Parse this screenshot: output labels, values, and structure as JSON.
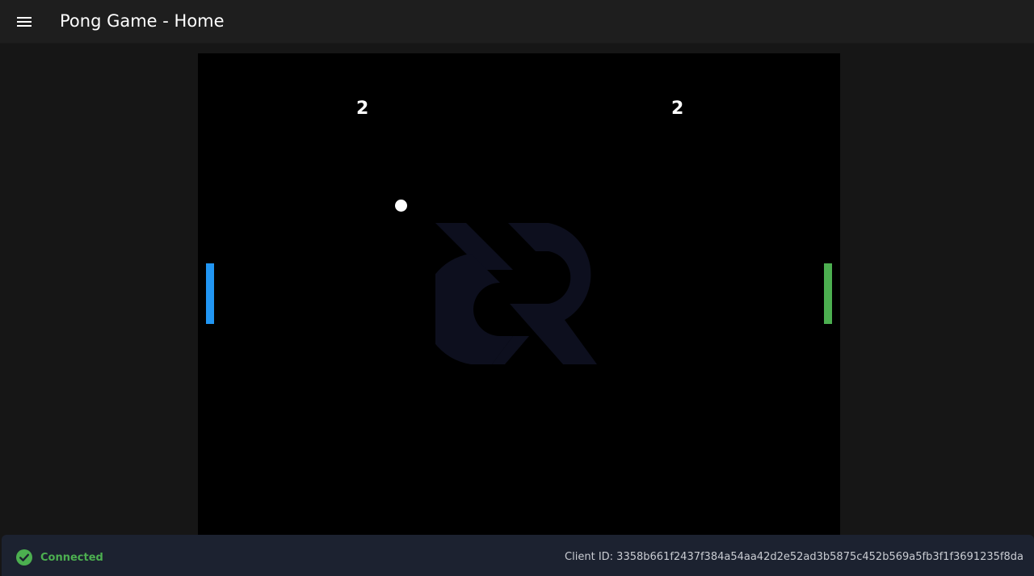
{
  "header": {
    "title": "Pong Game - Home",
    "menu_icon": "hamburger-menu-icon"
  },
  "game": {
    "scores": {
      "left": "2",
      "right": "2"
    },
    "paddles": {
      "left_color": "#2196f3",
      "right_color": "#4caf50"
    },
    "ball_color": "#ffffff",
    "watermark_icon": "decred-logo-icon"
  },
  "status": {
    "icon": "check-circle-icon",
    "connection_label": "Connected",
    "client_id": "Client ID: 3358b661f2437f384a54aa42d2e52ad3b5875c452b569a5fb3f1f3691235f8da",
    "accent_color": "#4caf50"
  }
}
